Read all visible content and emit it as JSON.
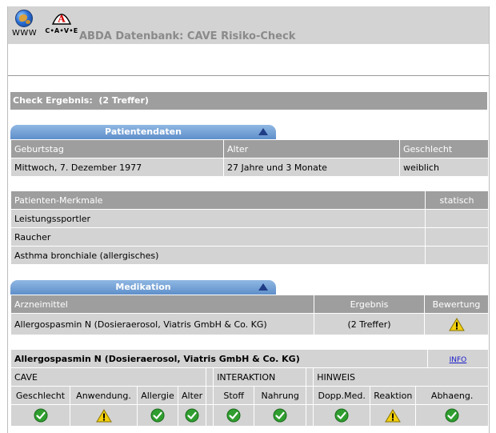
{
  "header": {
    "www_label": "WWW",
    "cave_label": "C•A•V•E",
    "title": "ABDA Datenbank: CAVE Risiko-Check"
  },
  "result": {
    "label": "Check Ergebnis:",
    "hits": "(2 Treffer)"
  },
  "patient": {
    "tab_label": "Patientendaten",
    "columns": [
      "Geburtstag",
      "Alter",
      "Geschlecht"
    ],
    "values": [
      "Mittwoch, 7. Dezember 1977",
      "27 Jahre und 3 Monate",
      "weiblich"
    ]
  },
  "features": {
    "columns": [
      "Patienten-Merkmale",
      "statisch"
    ],
    "rows": [
      "Leistungssportler",
      "Raucher",
      "Asthma bronchiale (allergisches)"
    ]
  },
  "medication": {
    "tab_label": "Medikation",
    "columns": [
      "Arzneimittel",
      "Ergebnis",
      "Bewertung"
    ],
    "rows": [
      {
        "name": "Allergospasmin N (Dosieraerosol, Viatris GmbH & Co. KG)",
        "result": "(2 Treffer)",
        "rating_icon": "warning-icon"
      }
    ]
  },
  "detail": {
    "drug": "Allergospasmin N (Dosieraerosol, Viatris GmbH & Co. KG)",
    "info_link": "INFO",
    "groups": {
      "cave": "CAVE",
      "interaktion": "INTERAKTION",
      "hinweis": "HINWEIS"
    },
    "checks": [
      {
        "label": "Geschlecht",
        "status": "ok"
      },
      {
        "label": "Anwendung.",
        "status": "warning"
      },
      {
        "label": "Allergie",
        "status": "ok"
      },
      {
        "label": "Alter",
        "status": "ok"
      },
      {
        "label": "Stoff",
        "status": "ok"
      },
      {
        "label": "Nahrung",
        "status": "ok"
      },
      {
        "label": "Dopp.Med.",
        "status": "ok"
      },
      {
        "label": "Reaktion",
        "status": "warning"
      },
      {
        "label": "Abhaeng.",
        "status": "ok"
      }
    ]
  },
  "colors": {
    "header_gray": "#d3d3d3",
    "row_gray": "#d3d3d3",
    "header_cell": "#9e9e9e",
    "tab_blue": "#6f9bd2",
    "ok_green": "#2f9e2f",
    "warning_yellow": "#f2d00c"
  }
}
